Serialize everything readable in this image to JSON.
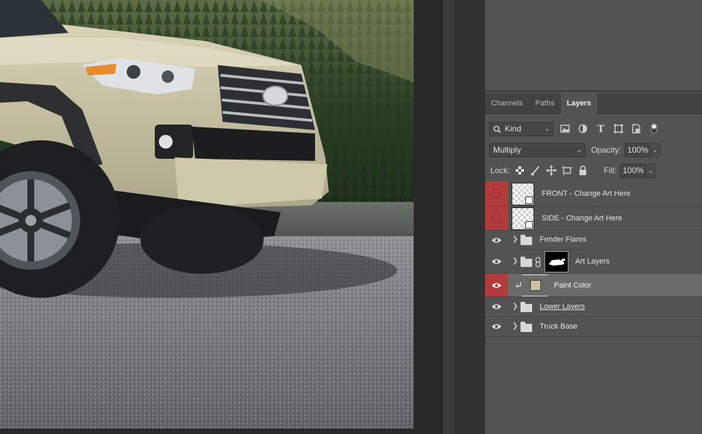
{
  "panel": {
    "tabs": [
      {
        "label": "Channels",
        "active": false
      },
      {
        "label": "Paths",
        "active": false
      },
      {
        "label": "Layers",
        "active": true
      }
    ],
    "filter": {
      "label": "Kind",
      "icons": [
        "image-filter-icon",
        "adjustment-filter-icon",
        "type-filter-icon",
        "shape-filter-icon",
        "smart-object-filter-icon",
        "filter-toggle-icon"
      ]
    },
    "blend_mode": "Multiply",
    "opacity_label": "Opacity:",
    "opacity_value": "100%",
    "lock_label": "Lock:",
    "lock_icons": [
      "lock-transparent-icon",
      "lock-image-icon",
      "lock-position-icon",
      "lock-artboard-icon",
      "lock-all-icon"
    ],
    "fill_label": "Fill:",
    "fill_value": "100%"
  },
  "layers": [
    {
      "name": "FRONT - Change Art Here",
      "type": "smart-object",
      "visible": false
    },
    {
      "name": "SIDE - Change Art Here",
      "type": "smart-object",
      "visible": false
    },
    {
      "name": "Fender Flares",
      "type": "group",
      "visible": true
    },
    {
      "name": "Art Layers",
      "type": "group-with-mask",
      "visible": true
    },
    {
      "name": "Paint Color",
      "type": "fill",
      "visible": true,
      "selected": true,
      "swatch": "#c9c2a2"
    },
    {
      "name": "Lower Layers",
      "type": "group",
      "visible": true
    },
    {
      "name": "Truck Base",
      "type": "group",
      "visible": true
    }
  ],
  "colors": {
    "panel": "#535353",
    "tabbar": "#424242",
    "selected_row": "#6b6b6b",
    "visibility_highlight": "#b23b3b",
    "truck_paint": "#c9c2a2"
  }
}
